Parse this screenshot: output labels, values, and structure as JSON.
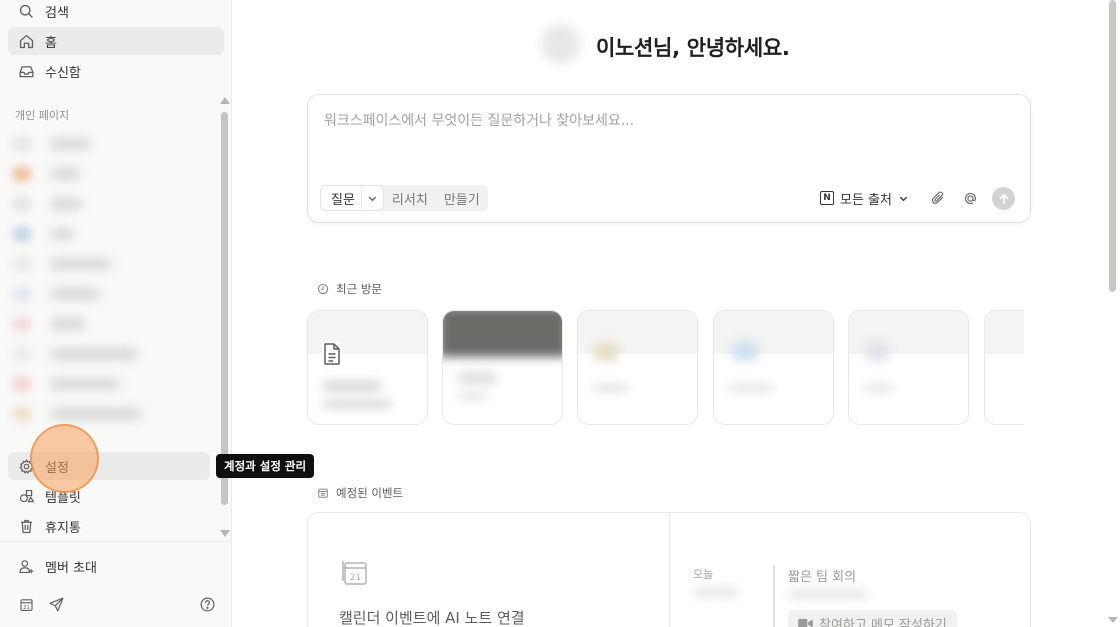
{
  "sidebar": {
    "nav": [
      {
        "label": "검색",
        "icon": "search-icon"
      },
      {
        "label": "홈",
        "icon": "home-icon",
        "active": true
      },
      {
        "label": "수신함",
        "icon": "inbox-icon"
      }
    ],
    "section_label": "개인 페이지",
    "bottom_nav": [
      {
        "label": "설정",
        "icon": "gear-icon"
      },
      {
        "label": "템플릿",
        "icon": "shapes-icon"
      },
      {
        "label": "휴지통",
        "icon": "trash-icon"
      }
    ],
    "invite_label": "멤버 초대",
    "footer_icons": [
      "calendar-icon",
      "send-icon",
      "help-icon"
    ],
    "tooltip": "계정과 설정 관리"
  },
  "main": {
    "greeting": "이노션님, 안녕하세요.",
    "ask": {
      "placeholder": "워크스페이스에서 무엇이든 질문하거나 찾아보세요...",
      "modes": [
        "질문",
        "리서치",
        "만들기"
      ],
      "source_label": "모든 출처"
    },
    "recent_label": "최근 방문",
    "events": {
      "label": "예정된 이벤트",
      "connect_label": "캘린더 이벤트에 AI 노트 연결",
      "today_label": "오늘",
      "event_title": "짧은 팀 회의",
      "event_button": "참여하고 메모 작성하기",
      "calendar_day": "21"
    }
  },
  "colors": {
    "sidebar_bg": "#f9f9f8",
    "text": "#37352f",
    "tooltip_bg": "#0f0f0f",
    "cursor_halo": "#f5a05a"
  }
}
